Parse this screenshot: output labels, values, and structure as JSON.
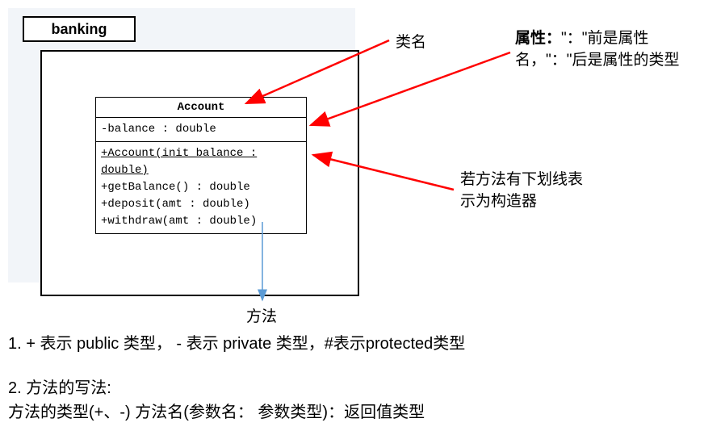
{
  "package": {
    "name": "banking"
  },
  "class": {
    "name": "Account",
    "attributes": [
      "-balance : double"
    ],
    "methods": [
      {
        "text": "+Account(init_balance : double)",
        "underlined": true
      },
      {
        "text": "+getBalance() : double",
        "underlined": false
      },
      {
        "text": "+deposit(amt : double)",
        "underlined": false
      },
      {
        "text": "+withdraw(amt : double)",
        "underlined": false
      }
    ]
  },
  "annotations": {
    "className": "类名",
    "attribute": "属性：\"：\"前是属性名，\"：\"后是属性的类型",
    "constructor": "若方法有下划线表示为构造器",
    "method": "方法"
  },
  "body": {
    "line1": "1. + 表示 public 类型， - 表示 private 类型，#表示protected类型",
    "line2_title": "2. 方法的写法:",
    "line2_detail": "方法的类型(+、-)  方法名(参数名： 参数类型)：返回值类型"
  }
}
